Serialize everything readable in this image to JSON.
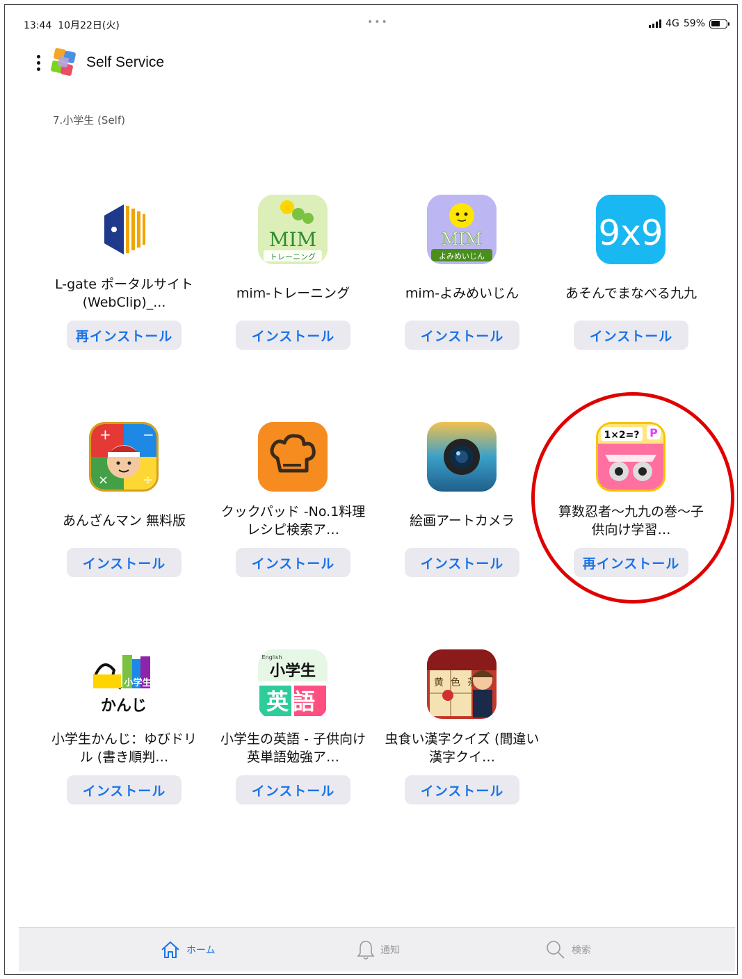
{
  "status_bar": {
    "time": "13:44",
    "date": "10月22日(火)",
    "multitask_dots": "•••",
    "network": "4G",
    "battery_percent": "59%",
    "battery_level": 0.59
  },
  "header": {
    "title": "Self Service"
  },
  "category": {
    "label": "7.小学生 (Self)"
  },
  "apps": [
    {
      "name": "L-gate ポータルサイト (WebClip)_...",
      "button": "再インストール",
      "icon": "l-gate-icon"
    },
    {
      "name": "mim-トレーニング",
      "button": "インストール",
      "icon": "mim-training-icon",
      "icon_text": "MIM",
      "icon_sub": "トレーニング"
    },
    {
      "name": "mim-よみめいじん",
      "button": "インストール",
      "icon": "mim-yomimeijin-icon",
      "icon_text": "MIM",
      "icon_sub": "よみめいじん"
    },
    {
      "name": "あそんでまなべる九九",
      "button": "インストール",
      "icon": "kuku-9x9-icon",
      "icon_text": "9x9"
    },
    {
      "name": "あんざんマン 無料版",
      "button": "インストール",
      "icon": "anzanman-icon"
    },
    {
      "name": "クックパッド -No.1料理レシピ検索ア…",
      "button": "インストール",
      "icon": "cookpad-icon"
    },
    {
      "name": "絵画アートカメラ",
      "button": "インストール",
      "icon": "art-camera-icon"
    },
    {
      "name": "算数忍者〜九九の巻〜子供向け学習…",
      "button": "再インストール",
      "icon": "sansu-ninja-icon",
      "icon_text": "1×2=?",
      "icon_badge": "P"
    },
    {
      "name": "小学生かんじ：ゆびドリル (書き順判…",
      "button": "インストール",
      "icon": "shogakusei-kanji-icon",
      "icon_text": "かんじ",
      "icon_sub": "小学生"
    },
    {
      "name": "小学生の英語 - 子供向け英単語勉強ア…",
      "button": "インストール",
      "icon": "shogakusei-eigo-icon",
      "icon_text": "英語",
      "icon_sub": "小学生",
      "icon_tag": "English"
    },
    {
      "name": "虫食い漢字クイズ (間違い漢字クイ…",
      "button": "インストール",
      "icon": "mushikui-kanji-icon",
      "icon_text": "新黄色茶"
    }
  ],
  "tab_bar": {
    "home": "ホーム",
    "notifications": "通知",
    "search": "検索"
  },
  "colors": {
    "accent": "#1a73e8",
    "button_bg": "#e9e9ef",
    "highlight_circle": "#e00000",
    "tab_bar_bg": "#efeff2"
  }
}
